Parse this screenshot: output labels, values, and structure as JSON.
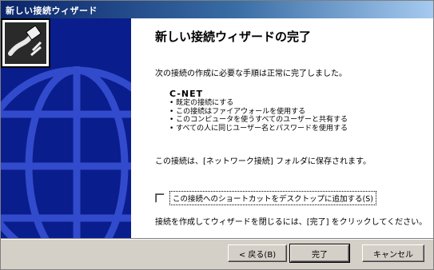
{
  "window": {
    "title": "新しい接続ウィザード"
  },
  "icons": {
    "banner_globe": "globe-icon",
    "wizard": "network-cable-icon"
  },
  "content": {
    "heading": "新しい接続ウィザードの完了",
    "intro": "次の接続の作成に必要な手順は正常に完了しました。",
    "connection_name": "C-NET",
    "bullets": [
      "既定の接続にする",
      "この接続はファイアウォールを使用する",
      "このコンピュータを使うすべてのユーザーと共有する",
      "すべての人に同じユーザー名とパスワードを使用する"
    ],
    "saved_note": "この接続は、[ネットワーク接続] フォルダに保存されます。",
    "shortcut_checkbox": {
      "label": "この接続へのショートカットをデスクトップに追加する(S)",
      "checked": false
    },
    "finish_note": "接続を作成してウィザードを閉じるには、[完了] をクリックしてください。"
  },
  "buttons": {
    "back": "< 戻る(B)",
    "finish": "完了",
    "cancel": "キャンセル"
  },
  "colors": {
    "banner": "#0a1d8c",
    "titlebar_start": "#0a246a",
    "titlebar_end": "#a6caf0"
  }
}
